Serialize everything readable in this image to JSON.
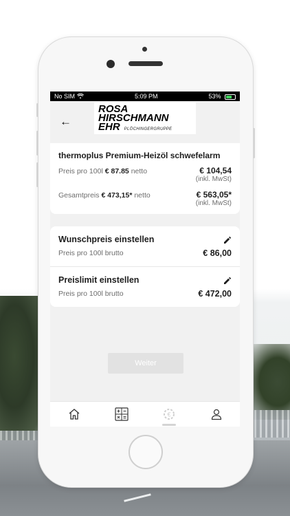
{
  "status_bar": {
    "carrier": "No SIM",
    "time": "5:09 PM",
    "battery": "53%"
  },
  "header": {
    "logo_line1": "ROSA",
    "logo_line2": "HIRSCHMANN",
    "logo_line3": "EHR",
    "logo_sub": "PLÖCHINGERGRUPPE"
  },
  "product": {
    "title": "thermoplus Premium-Heizöl schwefelarm",
    "price_per_100_label": "Preis pro 100l",
    "price_per_100_value": "€ 87.85",
    "price_per_100_suffix": "netto",
    "price_per_100_gross": "€ 104,54",
    "price_per_100_note": "(inkl. MwSt)",
    "total_label": "Gesamtpreis",
    "total_value": "€ 473,15*",
    "total_suffix": "netto",
    "total_gross": "€ 563,05*",
    "total_note": "(inkl. MwSt)"
  },
  "settings": [
    {
      "title": "Wunschpreis einstellen",
      "label": "Preis pro 100l brutto",
      "value": "€ 86,00"
    },
    {
      "title": "Preislimit einstellen",
      "label": "Preis pro 100l brutto",
      "value": "€ 472,00"
    }
  ],
  "actions": {
    "continue_label": "Weiter"
  },
  "tabbar": {
    "items": [
      "home-icon",
      "calculator-icon",
      "euro-settings-icon",
      "profile-icon"
    ],
    "active_index": 2
  },
  "colors": {
    "battery_green": "#3fd35c",
    "button_disabled": "#e2e2e2"
  }
}
